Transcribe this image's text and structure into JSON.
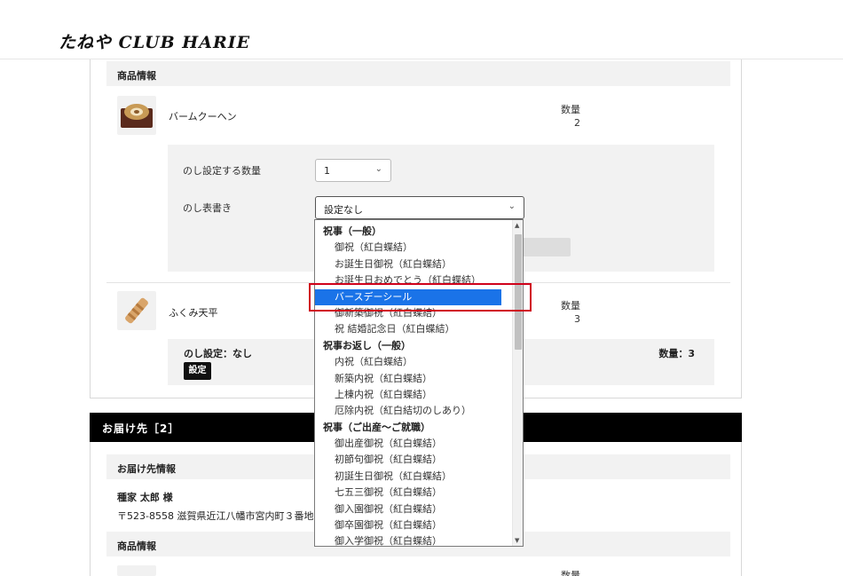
{
  "header": {
    "logo_text": "たねや CLUB HARIE"
  },
  "order": {
    "product_info_heading": "商品情報",
    "item1": {
      "name": "バームクーヘン",
      "qty_label": "数量",
      "qty_value": "2"
    },
    "noshi": {
      "qty_label": "のし設定する数量",
      "qty_selected": "1",
      "omote_label": "のし表書き",
      "omote_selected": "設定なし"
    },
    "item2": {
      "name": "ふくみ天平",
      "qty_label": "数量",
      "qty_value": "3"
    },
    "item2_noshi": {
      "status": "のし設定：なし",
      "set_button": "設定",
      "qty_summary": "数量：3"
    }
  },
  "dropdown": {
    "options": [
      {
        "type": "group",
        "label": "祝事（一般）"
      },
      {
        "type": "option",
        "label": "御祝（紅白蝶結）"
      },
      {
        "type": "option",
        "label": "お誕生日御祝（紅白蝶結）"
      },
      {
        "type": "option",
        "label": "お誕生日おめでとう（紅白蝶結）"
      },
      {
        "type": "option",
        "label": "バースデーシール",
        "selected": true
      },
      {
        "type": "option",
        "label": "御新築御祝（紅白蝶結）"
      },
      {
        "type": "option",
        "label": "祝 結婚記念日（紅白蝶結）"
      },
      {
        "type": "group",
        "label": "祝事お返し（一般）"
      },
      {
        "type": "option",
        "label": "内祝（紅白蝶結）"
      },
      {
        "type": "option",
        "label": "新築内祝（紅白蝶結）"
      },
      {
        "type": "option",
        "label": "上棟内祝（紅白蝶結）"
      },
      {
        "type": "option",
        "label": "厄除内祝（紅白結切のしあり）"
      },
      {
        "type": "group",
        "label": "祝事（ご出産〜ご就職）"
      },
      {
        "type": "option",
        "label": "御出産御祝（紅白蝶結）"
      },
      {
        "type": "option",
        "label": "初節句御祝（紅白蝶結）"
      },
      {
        "type": "option",
        "label": "初誕生日御祝（紅白蝶結）"
      },
      {
        "type": "option",
        "label": "七五三御祝（紅白蝶結）"
      },
      {
        "type": "option",
        "label": "御入園御祝（紅白蝶結）"
      },
      {
        "type": "option",
        "label": "御卒園御祝（紅白蝶結）"
      },
      {
        "type": "option",
        "label": "御入学御祝（紅白蝶結）"
      }
    ]
  },
  "delivery": {
    "heading": "お届け先［2］",
    "info_heading": "お届け先情報",
    "recipient_name": "種家 太郎 様",
    "address": "〒523-8558 滋賀県近江八幡市宮内町３番地",
    "product_info_heading": "商品情報",
    "qty_label": "数量"
  },
  "colors": {
    "selected_option": "#1a73e8",
    "highlight": "#d0021b",
    "bar_black": "#000000"
  }
}
